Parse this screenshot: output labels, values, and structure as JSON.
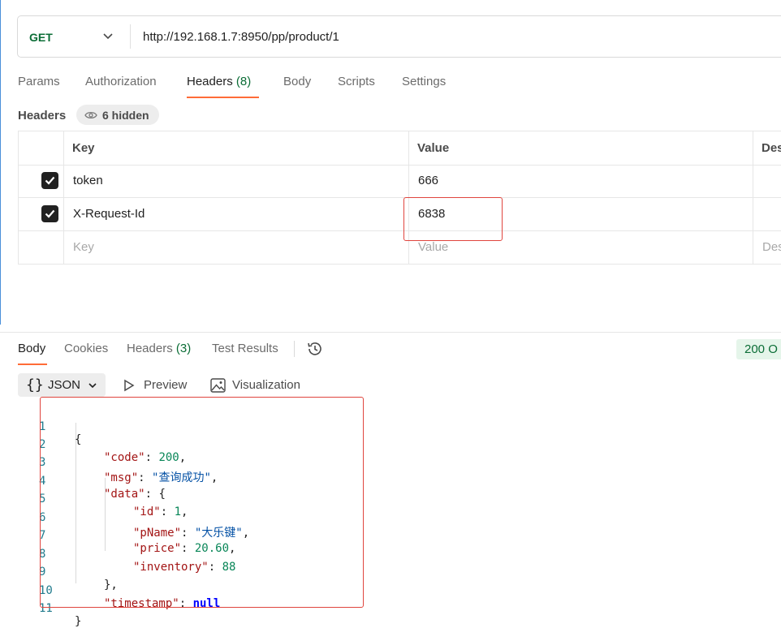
{
  "request": {
    "method": "GET",
    "url": "http://192.168.1.7:8950/pp/product/1"
  },
  "request_tabs": [
    {
      "label": "Params"
    },
    {
      "label": "Authorization"
    },
    {
      "label": "Headers",
      "count": "(8)"
    },
    {
      "label": "Body"
    },
    {
      "label": "Scripts"
    },
    {
      "label": "Settings"
    }
  ],
  "headers_section": {
    "label": "Headers",
    "hidden_label": "6 hidden"
  },
  "headers_table": {
    "columns": [
      "Key",
      "Value",
      "Des"
    ],
    "rows": [
      {
        "key": "token",
        "value": "666",
        "checked": true
      },
      {
        "key": "X-Request-Id",
        "value": "6838",
        "checked": true
      }
    ],
    "placeholder": {
      "key": "Key",
      "value": "Value",
      "description": "Des"
    }
  },
  "response_tabs": [
    {
      "label": "Body"
    },
    {
      "label": "Cookies"
    },
    {
      "label": "Headers",
      "count": "(3)"
    },
    {
      "label": "Test Results"
    }
  ],
  "status": "200 O",
  "format": {
    "brace": "{}",
    "label": "JSON",
    "preview": "Preview",
    "visualization": "Visualization"
  },
  "body_lines": [
    {
      "n": "1",
      "text": "{"
    },
    {
      "n": "2",
      "key": "\"code\"",
      "value": "200",
      "vtype": "n",
      "trail": ","
    },
    {
      "n": "3",
      "key": "\"msg\"",
      "value": "\"查询成功\"",
      "vtype": "s",
      "trail": ","
    },
    {
      "n": "4",
      "key": "\"data\"",
      "value": "{",
      "vtype": "p",
      "trail": ""
    },
    {
      "n": "5",
      "key": "\"id\"",
      "value": "1",
      "vtype": "n",
      "trail": ","
    },
    {
      "n": "6",
      "key": "\"pName\"",
      "value": "\"大乐键\"",
      "vtype": "s",
      "trail": ","
    },
    {
      "n": "7",
      "key": "\"price\"",
      "value": "20.60",
      "vtype": "n",
      "trail": ","
    },
    {
      "n": "8",
      "key": "\"inventory\"",
      "value": "88",
      "vtype": "n",
      "trail": ""
    },
    {
      "n": "9",
      "text": "},"
    },
    {
      "n": "10",
      "key": "\"timestamp\"",
      "value": "null",
      "vtype": "nl",
      "trail": ""
    },
    {
      "n": "11",
      "text": "}"
    }
  ],
  "colors": {
    "accent": "#ff6c37",
    "method": "#0b6d36",
    "highlight": "#e0453e"
  }
}
